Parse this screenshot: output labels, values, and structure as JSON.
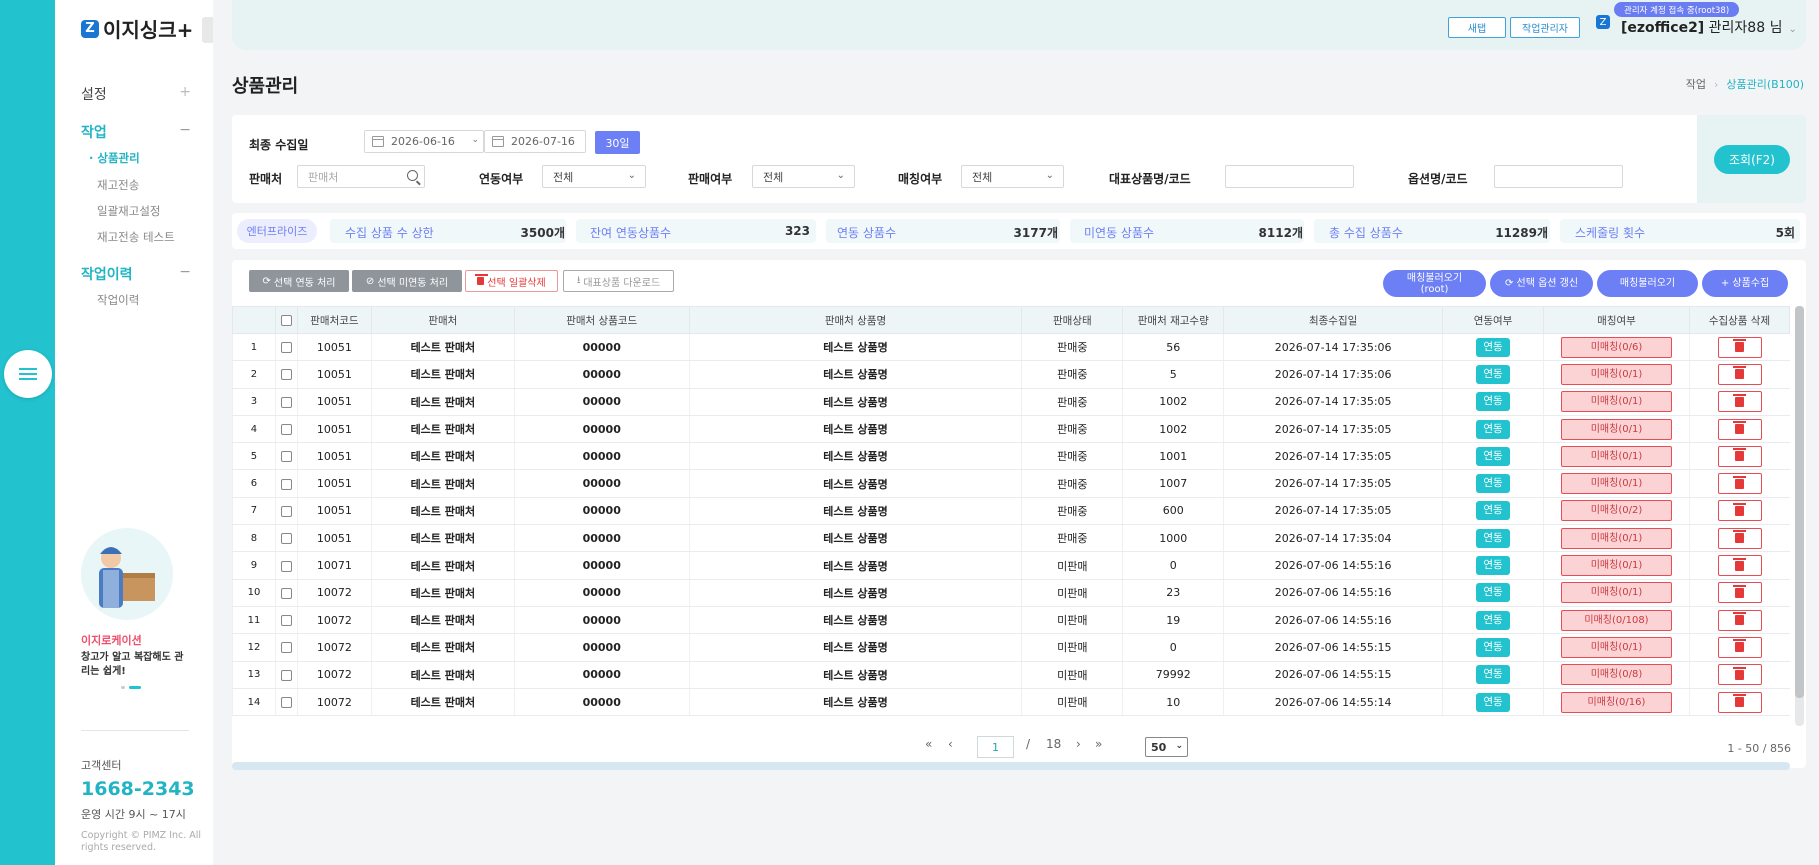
{
  "app": {
    "logo_text": "이지싱크+",
    "logo_mark": "Z"
  },
  "sidebar": {
    "sections": [
      {
        "label": "설정",
        "toggle": "+"
      },
      {
        "label": "작업",
        "toggle": "−"
      },
      {
        "label": "작업이력",
        "toggle": "−"
      }
    ],
    "work_items": [
      "· 상품관리",
      "재고전송",
      "일괄재고설정",
      "재고전송 테스트"
    ],
    "history_items": [
      "작업이력"
    ],
    "promo": {
      "title": "이지로케이션",
      "text": "창고가 알고 복잡해도 관리는 쉽게!"
    },
    "support": {
      "label": "고객센터",
      "phone": "1668-2343",
      "hours": "운영 시간 9시 ~ 17시",
      "copyright": "Copyright © PIMZ Inc. All rights reserved."
    }
  },
  "topbar": {
    "btn_new": "새탭",
    "btn_manager": "작업관리자",
    "admin_badge": "관리자 계정 접속 중(root38)",
    "user_mark": "Z",
    "user_company": "[ezoffice2]",
    "user_name": " 관리자88 님",
    "user_arrow": "⌄"
  },
  "page": {
    "title": "상품관리",
    "breadcrumb": [
      "작업",
      "›",
      "상품관리(B100)"
    ]
  },
  "filter": {
    "date_label": "최종 수집일",
    "date_from": "2026-06-16",
    "date_to": "2026-07-16",
    "period_btn": "30일",
    "seller_label": "판매처",
    "seller_placeholder": "판매처",
    "link_label": "연동여부",
    "link_value": "전체",
    "sale_label": "판매여부",
    "sale_value": "전체",
    "match_label": "매칭여부",
    "match_value": "전체",
    "product_label": "대표상품명/코드",
    "option_label": "옵션명/코드",
    "query_btn": "조회(F2)"
  },
  "stats": {
    "tag": "엔터프라이즈",
    "items": [
      {
        "label": "수집 상품 수 상한",
        "value": "3500개"
      },
      {
        "label": "잔여 연동상품수",
        "value": "323"
      },
      {
        "label": "연동 상품수",
        "value": "3177개"
      },
      {
        "label": "미연동 상품수",
        "value": "8112개"
      },
      {
        "label": "총 수집 상품수",
        "value": "11289개"
      },
      {
        "label": "스케줄링 횟수",
        "value": "5회"
      }
    ]
  },
  "actions": {
    "link": "선택 연동 처리",
    "unlink": "선택 미연동 처리",
    "bulk_delete": "선택 일괄삭제",
    "download": "대표상품 다운로드",
    "match_root": "매칭불러오기 (root)",
    "option_refresh": "선택 옵션 갱신",
    "match_load": "매칭불러오기",
    "collect": "+ 상품수집"
  },
  "table": {
    "headers": [
      "",
      "판매처코드",
      "판매처",
      "판매처 상품코드",
      "판매처 상품명",
      "판매상태",
      "판매처 재고수량",
      "최종수집일",
      "연동여부",
      "매칭여부",
      "수집상품 삭제"
    ],
    "rows": [
      {
        "no": "1",
        "code": "10051",
        "seller": "테스트 판매처",
        "pcode": "00000",
        "pname": "테스트 상품명",
        "status": "판매중",
        "stock": "56",
        "date": "2026-07-14 17:35:06",
        "link": "연동",
        "match": "미매칭(0/6)"
      },
      {
        "no": "2",
        "code": "10051",
        "seller": "테스트 판매처",
        "pcode": "00000",
        "pname": "테스트 상품명",
        "status": "판매중",
        "stock": "5",
        "date": "2026-07-14 17:35:06",
        "link": "연동",
        "match": "미매칭(0/1)"
      },
      {
        "no": "3",
        "code": "10051",
        "seller": "테스트 판매처",
        "pcode": "00000",
        "pname": "테스트 상품명",
        "status": "판매중",
        "stock": "1002",
        "date": "2026-07-14 17:35:05",
        "link": "연동",
        "match": "미매칭(0/1)"
      },
      {
        "no": "4",
        "code": "10051",
        "seller": "테스트 판매처",
        "pcode": "00000",
        "pname": "테스트 상품명",
        "status": "판매중",
        "stock": "1002",
        "date": "2026-07-14 17:35:05",
        "link": "연동",
        "match": "미매칭(0/1)"
      },
      {
        "no": "5",
        "code": "10051",
        "seller": "테스트 판매처",
        "pcode": "00000",
        "pname": "테스트 상품명",
        "status": "판매중",
        "stock": "1001",
        "date": "2026-07-14 17:35:05",
        "link": "연동",
        "match": "미매칭(0/1)"
      },
      {
        "no": "6",
        "code": "10051",
        "seller": "테스트 판매처",
        "pcode": "00000",
        "pname": "테스트 상품명",
        "status": "판매중",
        "stock": "1007",
        "date": "2026-07-14 17:35:05",
        "link": "연동",
        "match": "미매칭(0/1)"
      },
      {
        "no": "7",
        "code": "10051",
        "seller": "테스트 판매처",
        "pcode": "00000",
        "pname": "테스트 상품명",
        "status": "판매중",
        "stock": "600",
        "date": "2026-07-14 17:35:05",
        "link": "연동",
        "match": "미매칭(0/2)"
      },
      {
        "no": "8",
        "code": "10051",
        "seller": "테스트 판매처",
        "pcode": "00000",
        "pname": "테스트 상품명",
        "status": "판매중",
        "stock": "1000",
        "date": "2026-07-14 17:35:04",
        "link": "연동",
        "match": "미매칭(0/1)"
      },
      {
        "no": "9",
        "code": "10071",
        "seller": "테스트 판매처",
        "pcode": "00000",
        "pname": "테스트 상품명",
        "status": "미판매",
        "stock": "0",
        "date": "2026-07-06 14:55:16",
        "link": "연동",
        "match": "미매칭(0/1)"
      },
      {
        "no": "10",
        "code": "10072",
        "seller": "테스트 판매처",
        "pcode": "00000",
        "pname": "테스트 상품명",
        "status": "미판매",
        "stock": "23",
        "date": "2026-07-06 14:55:16",
        "link": "연동",
        "match": "미매칭(0/1)"
      },
      {
        "no": "11",
        "code": "10072",
        "seller": "테스트 판매처",
        "pcode": "00000",
        "pname": "테스트 상품명",
        "status": "미판매",
        "stock": "19",
        "date": "2026-07-06 14:55:16",
        "link": "연동",
        "match": "미매칭(0/108)"
      },
      {
        "no": "12",
        "code": "10072",
        "seller": "테스트 판매처",
        "pcode": "00000",
        "pname": "테스트 상품명",
        "status": "미판매",
        "stock": "0",
        "date": "2026-07-06 14:55:15",
        "link": "연동",
        "match": "미매칭(0/1)"
      },
      {
        "no": "13",
        "code": "10072",
        "seller": "테스트 판매처",
        "pcode": "00000",
        "pname": "테스트 상품명",
        "status": "미판매",
        "stock": "79992",
        "date": "2026-07-06 14:55:15",
        "link": "연동",
        "match": "미매칭(0/8)"
      },
      {
        "no": "14",
        "code": "10072",
        "seller": "테스트 판매처",
        "pcode": "00000",
        "pname": "테스트 상품명",
        "status": "미판매",
        "stock": "10",
        "date": "2026-07-06 14:55:14",
        "link": "연동",
        "match": "미매칭(0/16)"
      }
    ]
  },
  "pagination": {
    "first": "«",
    "prev": "‹",
    "current": "1",
    "slash": "/",
    "total": "18",
    "next": "›",
    "last": "»",
    "page_size": "50",
    "info": "1 - 50 / 856"
  },
  "colors": {
    "accent": "#22c3cf",
    "primary": "#6d7ff5",
    "danger": "#e84d55"
  }
}
